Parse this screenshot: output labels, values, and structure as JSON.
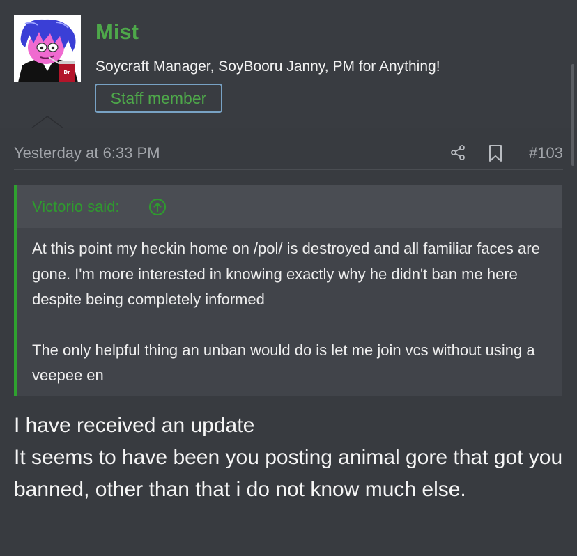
{
  "post": {
    "author": {
      "username": "Mist",
      "title": "Soycraft Manager, SoyBooru Janny, PM for Anything!",
      "badge": "Staff member",
      "avatar_text": "Dr Pepper",
      "avatar_colors": {
        "background": "#ffffff",
        "hair": "#3a3fd6",
        "skin": "#f06ad0",
        "suit": "#111111",
        "can": "#b3152a"
      }
    },
    "date": "Yesterday at 6:33 PM",
    "number": "#103",
    "actions": {
      "share_icon": "share-icon",
      "bookmark_icon": "bookmark-icon"
    },
    "quote": {
      "author_line": "Victorio said:",
      "expand_icon": "arrow-up-circle-icon",
      "paragraphs": [
        "At this point my heckin home on /pol/ is destroyed and all familiar faces are gone. I'm more interested in knowing exactly why he didn't ban me here despite being completely informed",
        "The only helpful thing an unban would do is let me join vcs without using a veepee en"
      ]
    },
    "body_lines": [
      "I have received an update",
      "It seems to have been you posting animal gore that got you banned, other than that i do not know much else."
    ]
  },
  "colors": {
    "page_background": "#383b40",
    "username": "#4ea84a",
    "quote_border": "#2fa12f",
    "badge_border": "#78a2c4",
    "meta_text": "#a2a5aa"
  }
}
